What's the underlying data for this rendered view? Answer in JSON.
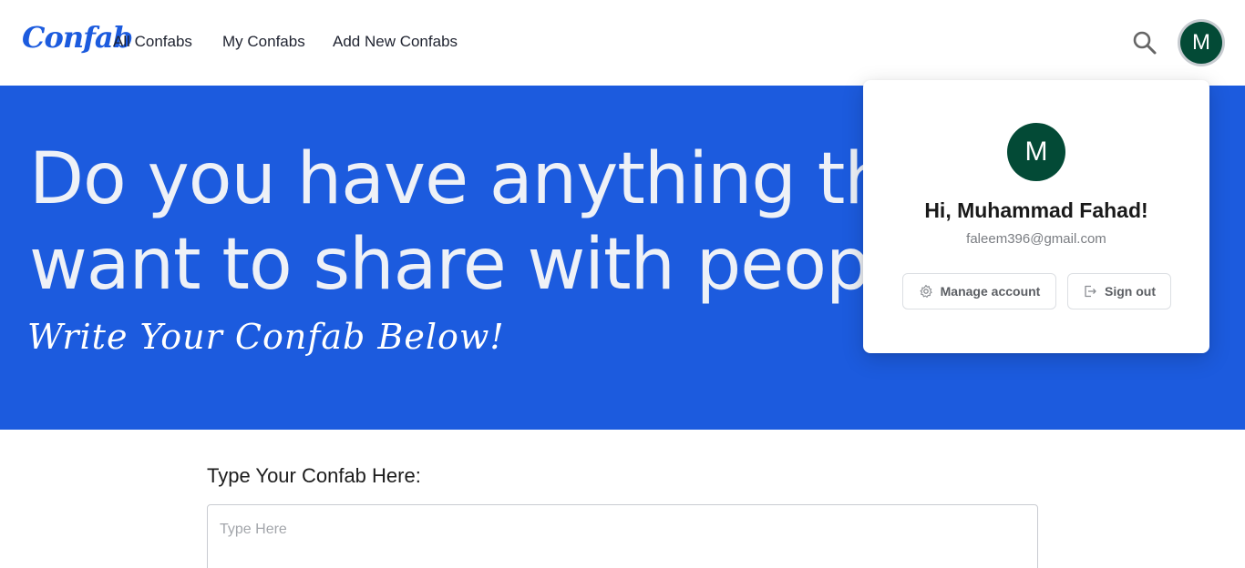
{
  "navbar": {
    "logo": "Confab",
    "links": [
      "All Confabs",
      "My Confabs",
      "Add New Confabs"
    ],
    "search_icon": "search-icon",
    "avatar_initial": "M"
  },
  "hero": {
    "line1": "Do you have anything that you",
    "line2": "want to share with people?",
    "subtitle": "Write Your Confab Below!"
  },
  "form": {
    "label": "Type Your Confab Here:",
    "placeholder": "Type Here",
    "value": ""
  },
  "user_menu": {
    "avatar_initial": "M",
    "greeting": "Hi, Muhammad Fahad!",
    "email": "faleem396@gmail.com",
    "manage_label": "Manage account",
    "manage_icon": "gear-icon",
    "signout_label": "Sign out",
    "signout_icon": "sign-out-icon"
  },
  "colors": {
    "brand_blue": "#1c5bde",
    "avatar_green": "#034a36"
  }
}
